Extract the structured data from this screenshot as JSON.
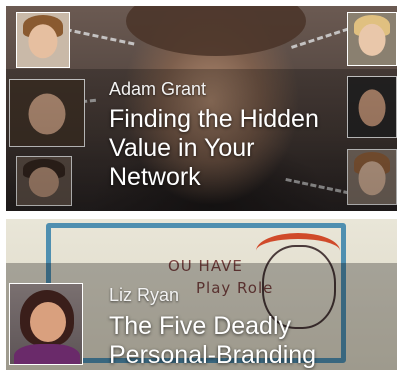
{
  "cards": [
    {
      "author": "Adam Grant",
      "title_lines": [
        "Finding the Hidden",
        "Value in Your",
        "Network"
      ],
      "thumbnails": [
        "person-photo",
        "person-photo",
        "person-photo",
        "person-photo",
        "person-photo",
        "person-photo",
        "person-photo",
        "person-photo"
      ]
    },
    {
      "author": "Liz Ryan",
      "title_lines": [
        "The Five Deadly",
        "Personal-Branding"
      ],
      "background_scribble": [
        "OU HAVE",
        "Play Role"
      ]
    }
  ],
  "colors": {
    "overlay_text": "#ffffff",
    "drawing_frame": "#4f8fb0",
    "drawing_hair": "#d04a2a"
  }
}
